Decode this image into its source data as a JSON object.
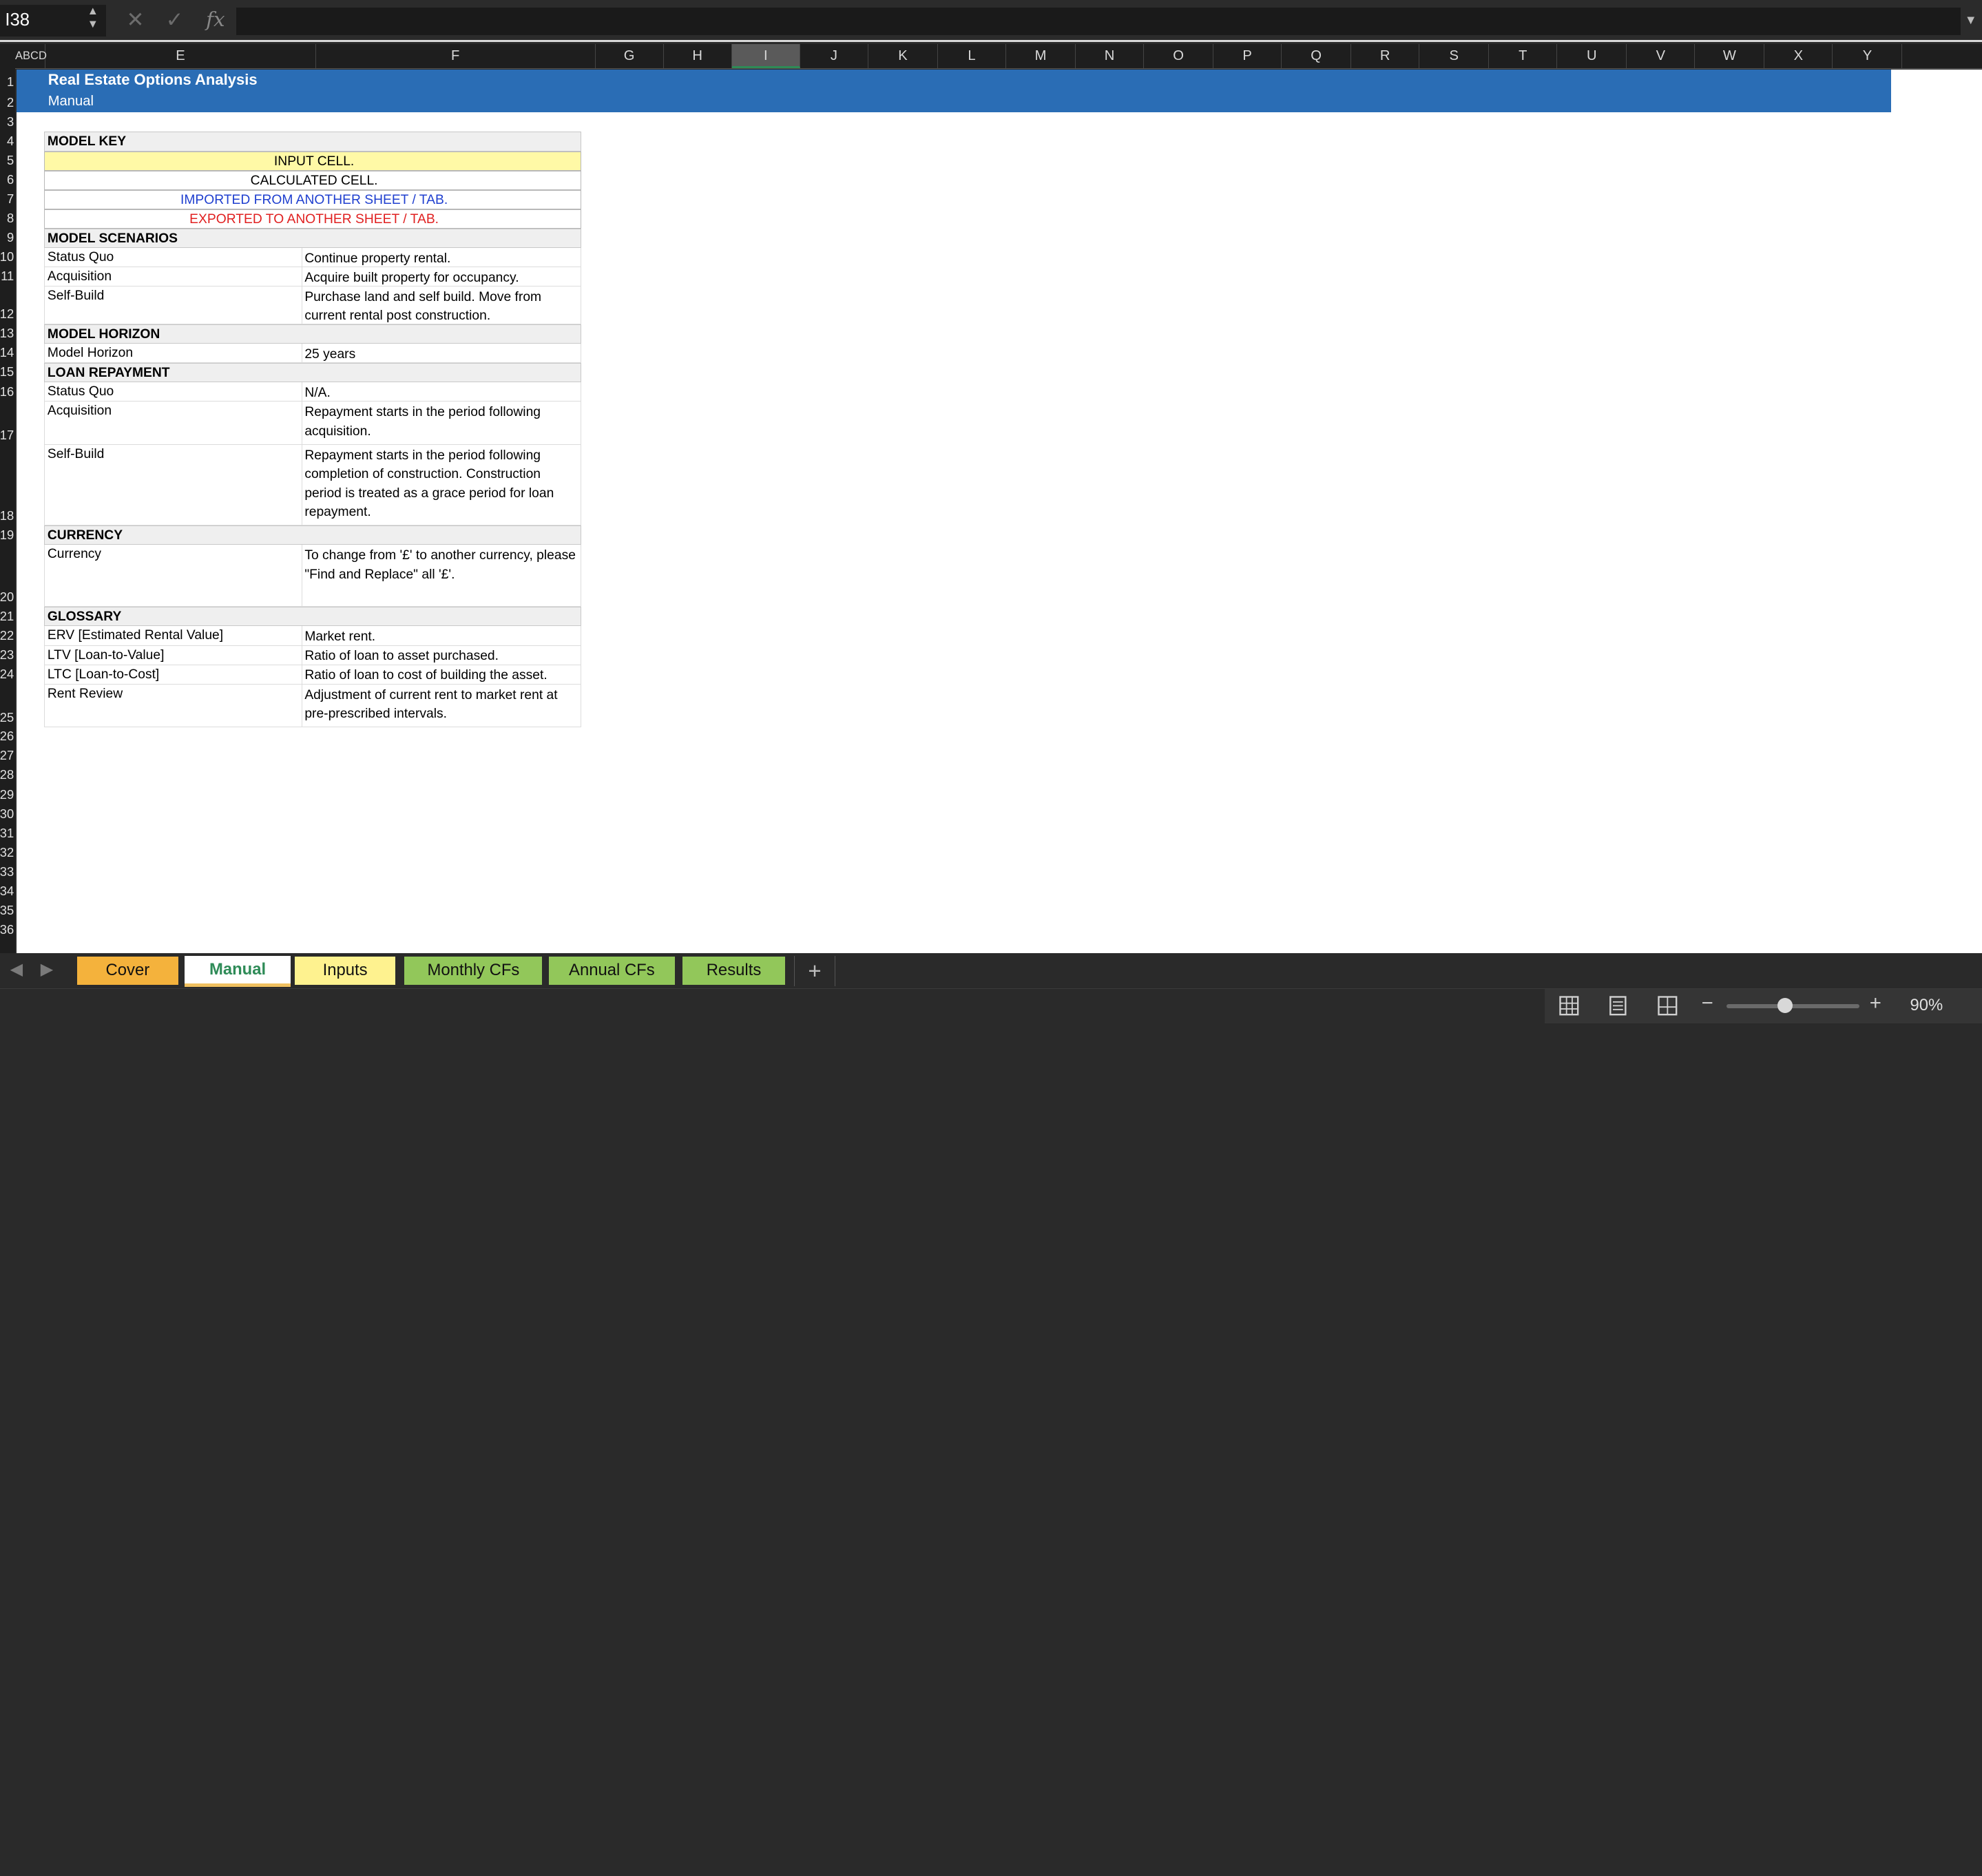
{
  "formula_bar": {
    "name_box": "I38",
    "formula": ""
  },
  "columns": [
    {
      "label": "ABCD"
    },
    {
      "label": "E"
    },
    {
      "label": "F"
    },
    {
      "label": "G"
    },
    {
      "label": "H"
    },
    {
      "label": "I",
      "selected": true
    },
    {
      "label": "J"
    },
    {
      "label": "K"
    },
    {
      "label": "L"
    },
    {
      "label": "M"
    },
    {
      "label": "N"
    },
    {
      "label": "O"
    },
    {
      "label": "P"
    },
    {
      "label": "Q"
    },
    {
      "label": "R"
    },
    {
      "label": "S"
    },
    {
      "label": "T"
    },
    {
      "label": "U"
    },
    {
      "label": "V"
    },
    {
      "label": "W"
    },
    {
      "label": "X"
    },
    {
      "label": "Y"
    }
  ],
  "rows": [
    "1",
    "2",
    "3",
    "4",
    "5",
    "6",
    "7",
    "8",
    "9",
    "10",
    "11",
    "12",
    "13",
    "14",
    "15",
    "16",
    "17",
    "18",
    "19",
    "20",
    "21",
    "22",
    "23",
    "24",
    "25",
    "26",
    "27",
    "28",
    "29",
    "30",
    "31",
    "32",
    "33",
    "34",
    "35",
    "36"
  ],
  "sheet": {
    "title": "Real Estate Options Analysis",
    "subtitle": "Manual",
    "model_key": {
      "header": "MODEL KEY",
      "items": [
        {
          "text": "INPUT CELL.",
          "bg": "#fff9a6",
          "color": "#000000"
        },
        {
          "text": "CALCULATED CELL.",
          "bg": "#ffffff",
          "color": "#000000"
        },
        {
          "text": "IMPORTED FROM ANOTHER SHEET / TAB.",
          "bg": "#ffffff",
          "color": "#1f3fcf"
        },
        {
          "text": "EXPORTED TO ANOTHER SHEET / TAB.",
          "bg": "#ffffff",
          "color": "#e02020"
        }
      ]
    },
    "scenarios": {
      "header": "MODEL SCENARIOS",
      "rows": [
        {
          "label": "Status Quo",
          "value": "Continue property rental."
        },
        {
          "label": "Acquisition",
          "value": "Acquire built property for occupancy."
        },
        {
          "label": "Self-Build",
          "value": "Purchase land and self build. Move from current rental post construction."
        }
      ]
    },
    "horizon": {
      "header": "MODEL HORIZON",
      "rows": [
        {
          "label": "Model Horizon",
          "value": "25 years"
        }
      ]
    },
    "loan": {
      "header": "LOAN REPAYMENT",
      "rows": [
        {
          "label": "Status Quo",
          "value": "N/A."
        },
        {
          "label": "Acquisition",
          "value": "Repayment starts in the period following acquisition."
        },
        {
          "label": "Self-Build",
          "value": "Repayment starts in the period following completion of construction. Construction period is treated as a grace period for loan repayment."
        }
      ]
    },
    "currency": {
      "header": "CURRENCY",
      "rows": [
        {
          "label": "Currency",
          "value": "To change from '£' to another currency, please \"Find and Replace\" all '£'."
        }
      ]
    },
    "glossary": {
      "header": "GLOSSARY",
      "rows": [
        {
          "label": "ERV [Estimated Rental Value]",
          "value": "Market rent."
        },
        {
          "label": "LTV [Loan-to-Value]",
          "value": "Ratio of loan to asset purchased."
        },
        {
          "label": "LTC [Loan-to-Cost]",
          "value": "Ratio of loan to cost of building the asset."
        },
        {
          "label": "Rent Review",
          "value": "Adjustment of current rent to market rent at pre-prescribed intervals."
        }
      ]
    }
  },
  "tabs": [
    {
      "label": "Cover",
      "color": "#f4b23c"
    },
    {
      "label": "Manual",
      "color": "#ffffff",
      "active": true
    },
    {
      "label": "Inputs",
      "color": "#fef28f"
    },
    {
      "label": "Monthly CFs",
      "color": "#92c75a"
    },
    {
      "label": "Annual CFs",
      "color": "#92c75a"
    },
    {
      "label": "Results",
      "color": "#92c75a"
    }
  ],
  "status": {
    "zoom": "90%",
    "zoom_fraction": 0.44
  }
}
